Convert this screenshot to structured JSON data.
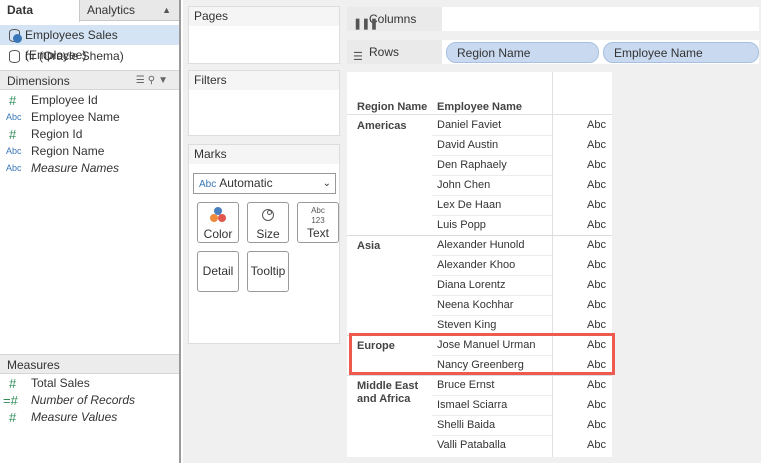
{
  "left_pane": {
    "tabs": [
      "Data",
      "Analytics"
    ],
    "data_sources": [
      "Employees Sales (Employee)",
      "hr (Oracle Shema)"
    ],
    "dimensions_header": "Dimensions",
    "dimensions": [
      {
        "icon": "#",
        "label": "Employee Id"
      },
      {
        "icon": "Abc",
        "label": "Employee Name"
      },
      {
        "icon": "#",
        "label": "Region Id"
      },
      {
        "icon": "Abc",
        "label": "Region Name"
      },
      {
        "icon": "Abc",
        "label": "Measure Names"
      }
    ],
    "measures_header": "Measures",
    "measures": [
      {
        "icon": "#",
        "label": "Total Sales"
      },
      {
        "icon": "=#",
        "label": "Number of Records"
      },
      {
        "icon": "#",
        "label": "Measure Values"
      }
    ]
  },
  "cards": {
    "pages": "Pages",
    "filters": "Filters",
    "marks": "Marks",
    "mark_type": "Automatic",
    "mark_type_icon": "Abc",
    "buttons": [
      "Color",
      "Size",
      "Text",
      "Detail",
      "Tooltip"
    ],
    "text_button_icon": "Abc 123"
  },
  "shelves": {
    "columns_label": "Columns",
    "rows_label": "Rows",
    "rows_pills": [
      "Region Name",
      "Employee Name"
    ]
  },
  "view": {
    "headers": [
      "Region Name",
      "Employee Name"
    ],
    "cell_value": "Abc",
    "regions": [
      {
        "name": "Americas",
        "employees": [
          "Daniel Faviet",
          "David Austin",
          "Den Raphaely",
          "John Chen",
          "Lex De Haan",
          "Luis Popp"
        ]
      },
      {
        "name": "Asia",
        "employees": [
          "Alexander Hunold",
          "Alexander Khoo",
          "Diana Lorentz",
          "Neena Kochhar",
          "Steven King"
        ]
      },
      {
        "name": "Europe",
        "employees": [
          "Jose Manuel Urman",
          "Nancy Greenberg"
        ]
      },
      {
        "name": "Middle East and Africa",
        "employees": [
          "Bruce Ernst",
          "Ismael Sciarra",
          "Shelli Baida",
          "Valli Pataballa"
        ]
      }
    ],
    "highlight_color": "#ee5a4f"
  }
}
